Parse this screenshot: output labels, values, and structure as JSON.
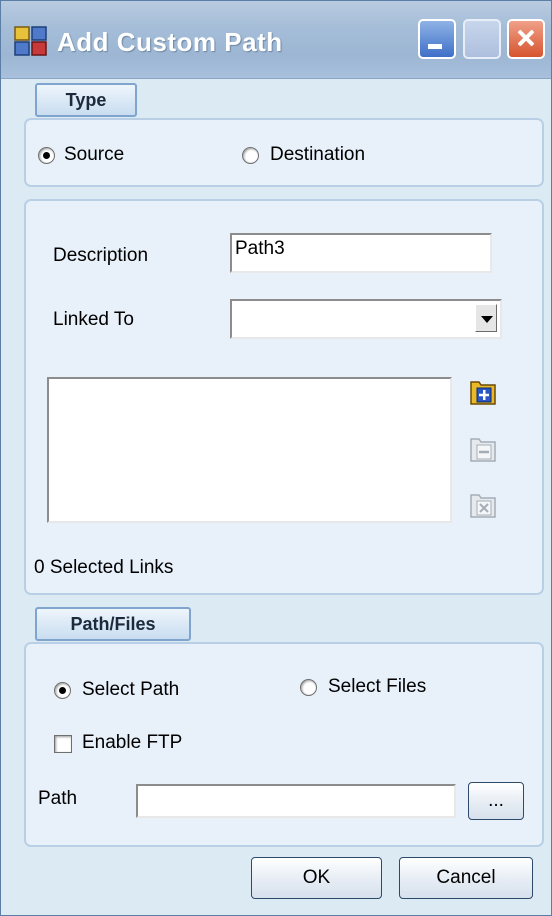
{
  "window": {
    "title": "Add Custom Path",
    "icon": "app-icon"
  },
  "title_buttons": [
    "minimize-icon",
    "maximize-icon",
    "close-icon"
  ],
  "type_section": {
    "tab_label": "Type",
    "options": [
      {
        "label": "Source",
        "checked": true
      },
      {
        "label": "Destination",
        "checked": false
      }
    ]
  },
  "details": {
    "description_label": "Description",
    "description_value": "Path3",
    "linked_to_label": "Linked To",
    "linked_to_value": "",
    "links_list_items": [],
    "selected_links_text": "0 Selected Links",
    "side_buttons": [
      "add-link-icon",
      "remove-link-icon",
      "clear-links-icon"
    ]
  },
  "path_files_section": {
    "tab_label": "Path/Files",
    "options": [
      {
        "label": "Select Path",
        "checked": true
      },
      {
        "label": "Select Files",
        "checked": false
      }
    ],
    "enable_ftp_label": "Enable FTP",
    "enable_ftp_checked": false,
    "path_label": "Path",
    "path_value": "",
    "browse_label": "..."
  },
  "buttons": {
    "ok": "OK",
    "cancel": "Cancel"
  },
  "colors": {
    "title_gradient": "#a5bdd8",
    "dialog_bg": "#dceaf4",
    "group_bg": "#e8f1fa",
    "close_red": "#d6542e"
  }
}
